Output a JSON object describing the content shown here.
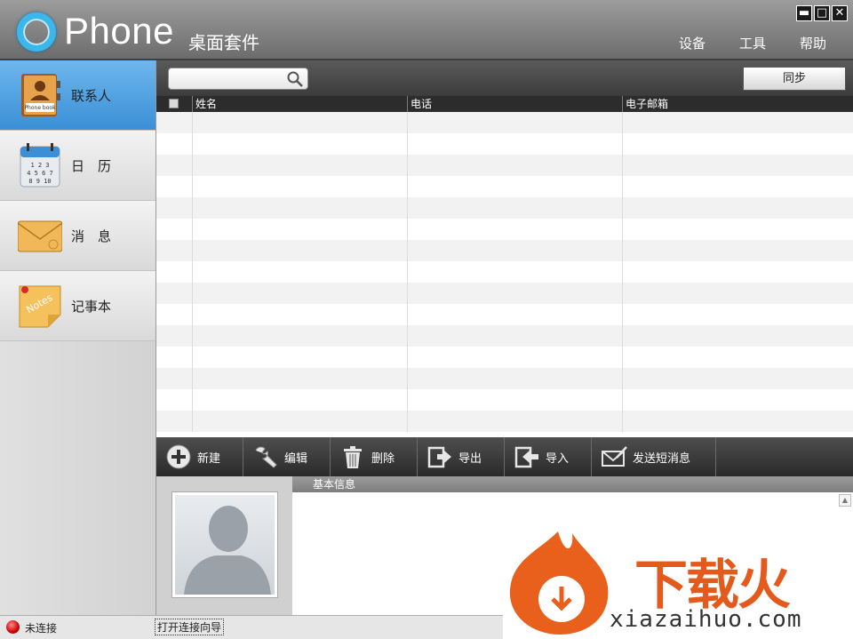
{
  "app": {
    "logo_text": "Phone",
    "subtitle": "桌面套件"
  },
  "window_controls": {
    "minimize": "▬",
    "maximize": "□",
    "close": "✕"
  },
  "menu": [
    "设备",
    "工具",
    "帮助"
  ],
  "sidebar": {
    "items": [
      {
        "label": "联系人",
        "icon": "phone-book-icon",
        "active": true
      },
      {
        "label": "日　历",
        "icon": "calendar-icon",
        "active": false
      },
      {
        "label": "消　息",
        "icon": "envelope-icon",
        "active": false
      },
      {
        "label": "记事本",
        "icon": "notes-icon",
        "active": false
      }
    ]
  },
  "search": {
    "value": "",
    "placeholder": ""
  },
  "sync_label": "同步",
  "table": {
    "columns": [
      "姓名",
      "电话",
      "电子邮箱"
    ],
    "row_count": 15
  },
  "actions": [
    {
      "label": "新建",
      "icon": "add-icon"
    },
    {
      "label": "编辑",
      "icon": "wrench-icon"
    },
    {
      "label": "删除",
      "icon": "trash-icon"
    },
    {
      "label": "导出",
      "icon": "export-icon"
    },
    {
      "label": "导入",
      "icon": "import-icon"
    },
    {
      "label": "发送短消息",
      "icon": "send-sms-icon"
    }
  ],
  "detail": {
    "tab_label": "基本信息"
  },
  "status": {
    "text": "未连接",
    "link": "打开连接向导"
  },
  "watermark": {
    "brand": "下载火",
    "url": "xiazaihuo.com"
  },
  "colors": {
    "accent": "#39b8ee",
    "active_nav": "#3a8fd6",
    "status_disconnected": "#d10000",
    "watermark": "#e35a1c"
  }
}
